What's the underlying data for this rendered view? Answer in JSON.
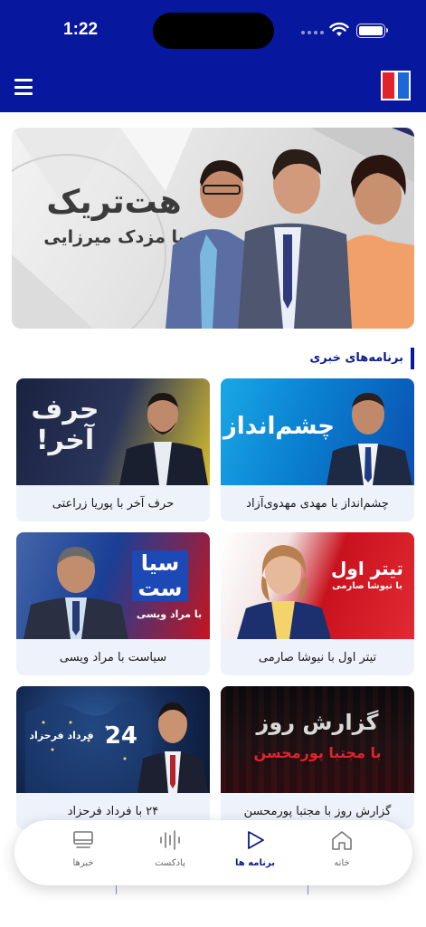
{
  "status_bar": {
    "time": "1:22"
  },
  "hero": {
    "title_line1": "هت‌تریک",
    "title_line2": "با مزدک میرزایی"
  },
  "section": {
    "title": "برنامه‌های خبری"
  },
  "programs": [
    {
      "caption": "چشم‌انداز با مهدی مهدوی‌آزاد",
      "thumb_text": "چشم‌انداز"
    },
    {
      "caption": "حرف آخر با پوریا زراعتی",
      "thumb_text_1": "حرف",
      "thumb_text_2": "آخر!"
    },
    {
      "caption": "تیتر اول با نیوشا صارمی",
      "thumb_text_1": "تیتر اول",
      "thumb_text_2": "با نیوشا صارمی"
    },
    {
      "caption": "سیاست با مراد ویسی",
      "thumb_text_1": "سیا",
      "thumb_text_2": "ست",
      "thumb_text_3": "با مراد ویسی"
    },
    {
      "caption": "گزارش روز با مجتبا پورمحسن",
      "thumb_text_1": "گزارش روز",
      "thumb_text_2": "با مجتبا پورمحسن"
    },
    {
      "caption": "۲۴ با فرداد فرحزاد",
      "thumb_text_1": "24",
      "thumb_text_2": "فرداد فرحزاد"
    }
  ],
  "tabbar": {
    "home": "خانه",
    "programs": "برنامه ها",
    "podcast": "پادکست",
    "news": "خبرها"
  },
  "colors": {
    "brand": "#07179e",
    "accent_red": "#e3232c",
    "accent_blue": "#1d67d8"
  }
}
